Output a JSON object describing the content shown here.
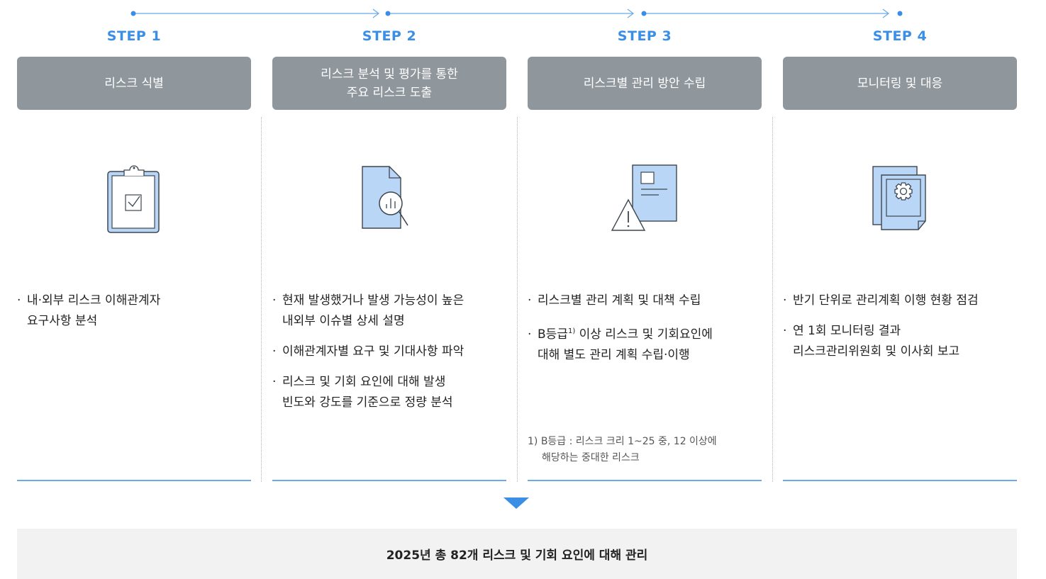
{
  "colors": {
    "accent": "#3a8ee6",
    "box": "#8f969c",
    "icon_fill": "#b9d6f7",
    "icon_stroke": "#3d4650"
  },
  "steps": [
    {
      "label": "STEP 1",
      "title": "리스크 식별",
      "icon": "clipboard-check-icon",
      "items": [
        "내·외부 리스크 이해관계자\n요구사항 분석"
      ]
    },
    {
      "label": "STEP 2",
      "title": "리스크 분석 및 평가를 통한\n주요 리스크 도출",
      "icon": "document-magnifier-chart-icon",
      "items": [
        "현재 발생했거나 발생 가능성이 높은\n내외부 이슈별 상세 설명",
        "이해관계자별 요구 및 기대사항 파악",
        "리스크 및 기회 요인에 대해 발생\n빈도와 강도를 기준으로 정량 분석"
      ]
    },
    {
      "label": "STEP 3",
      "title": "리스크별 관리 방안 수립",
      "icon": "document-warning-icon",
      "items": [
        "리스크별 관리 계획 및 대책 수립",
        "B등급|1)| 이상 리스크 및 기회요인에\n대해 별도 관리 계획 수립·이행"
      ],
      "footnote": {
        "line1": "1) B등급 : 리스크 크리 1~25 중, 12 이상에",
        "line2": "해당하는 중대한 리스크"
      }
    },
    {
      "label": "STEP 4",
      "title": "모니터링 및 대응",
      "icon": "document-gear-icon",
      "items": [
        "반기 단위로 관리계획 이행 현황 점검",
        "연 1회 모니터링 결과\n리스크관리위원회 및 이사회 보고"
      ]
    }
  ],
  "summary": "2025년 총 82개 리스크 및 기회 요인에 대해 관리"
}
